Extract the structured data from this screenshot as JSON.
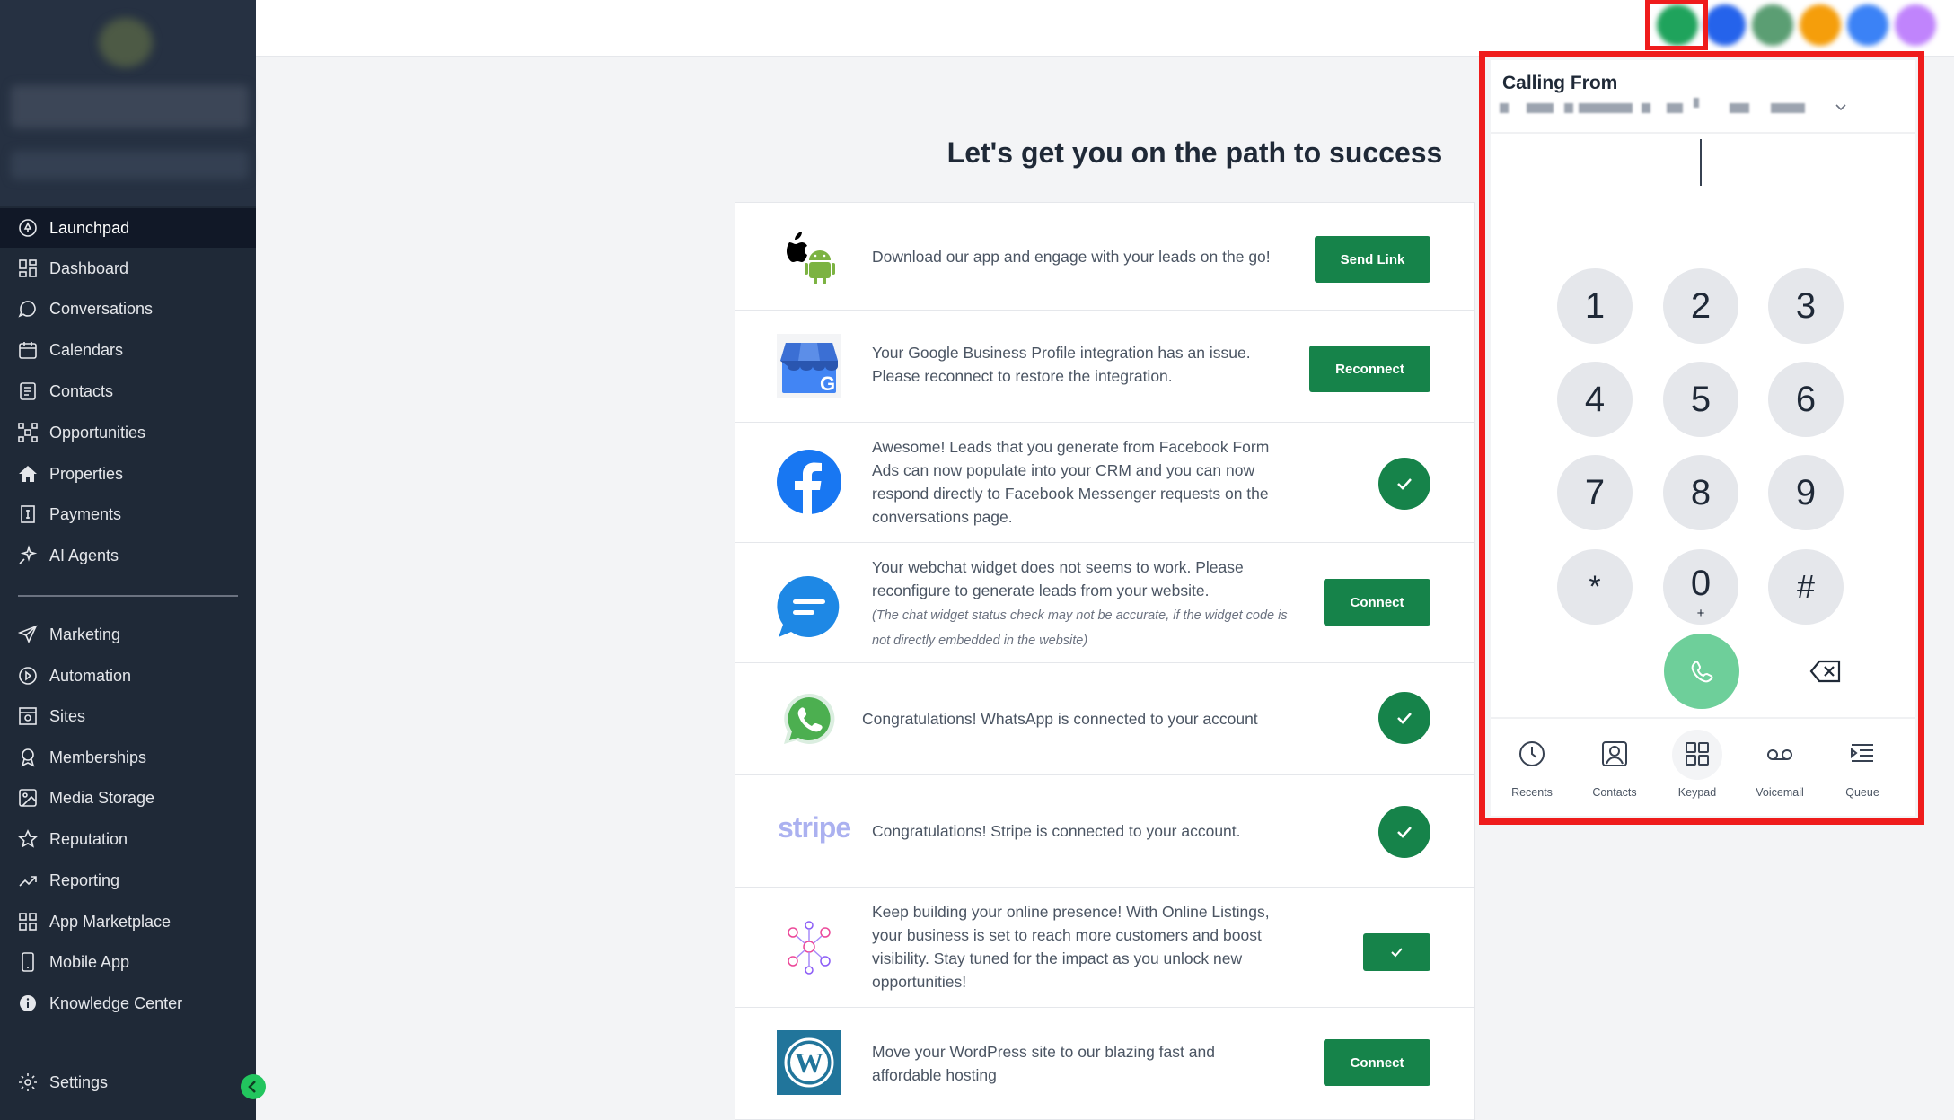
{
  "sidebar": {
    "items": [
      {
        "label": "Launchpad",
        "icon": "launchpad-icon",
        "active": true
      },
      {
        "label": "Dashboard",
        "icon": "dashboard-icon"
      },
      {
        "label": "Conversations",
        "icon": "chat-bubble-icon"
      },
      {
        "label": "Calendars",
        "icon": "calendar-icon"
      },
      {
        "label": "Contacts",
        "icon": "contacts-icon"
      },
      {
        "label": "Opportunities",
        "icon": "opportunities-icon"
      },
      {
        "label": "Properties",
        "icon": "home-icon"
      },
      {
        "label": "Payments",
        "icon": "payments-icon"
      },
      {
        "label": "AI Agents",
        "icon": "sparkle-icon"
      }
    ],
    "items2": [
      {
        "label": "Marketing",
        "icon": "send-icon"
      },
      {
        "label": "Automation",
        "icon": "automation-icon"
      },
      {
        "label": "Sites",
        "icon": "sites-icon"
      },
      {
        "label": "Memberships",
        "icon": "award-icon"
      },
      {
        "label": "Media Storage",
        "icon": "image-icon"
      },
      {
        "label": "Reputation",
        "icon": "star-icon"
      },
      {
        "label": "Reporting",
        "icon": "trend-icon"
      },
      {
        "label": "App Marketplace",
        "icon": "grid-icon"
      },
      {
        "label": "Mobile App",
        "icon": "phone-device-icon"
      },
      {
        "label": "Knowledge Center",
        "icon": "info-icon"
      }
    ],
    "settings": {
      "label": "Settings",
      "icon": "gear-icon"
    }
  },
  "main": {
    "title": "Let's get you on the path to success",
    "cards": [
      {
        "text": "Download our app and engage with your leads on the go!",
        "action": "Send Link"
      },
      {
        "text": "Your Google Business Profile integration has an issue. Please reconnect to restore the integration.",
        "action": "Reconnect"
      },
      {
        "text": "Awesome! Leads that you generate from Facebook Form Ads can now populate into your CRM and you can now respond directly to Facebook Messenger requests on the conversations page.",
        "status": "connected"
      },
      {
        "text": "Your webchat widget does not seems to work. Please reconfigure to generate leads from your website.",
        "note": "(The chat widget status check may not be accurate, if the widget code is not directly embedded in the website)",
        "action": "Connect"
      },
      {
        "text": "Congratulations! WhatsApp is connected to your account",
        "status": "connected"
      },
      {
        "text": "Congratulations! Stripe is connected to your account.",
        "logo": "stripe",
        "status": "connected"
      },
      {
        "text": "Keep building your online presence! With Online Listings, your business is set to reach more customers and boost visibility. Stay tuned for the impact as you unlock new opportunities!",
        "status": "connected"
      },
      {
        "text": "Move your WordPress site to our blazing fast and affordable hosting",
        "action": "Connect"
      }
    ]
  },
  "dialer": {
    "calling_from": "Calling From",
    "keys": [
      {
        "d": "1"
      },
      {
        "d": "2"
      },
      {
        "d": "3"
      },
      {
        "d": "4"
      },
      {
        "d": "5"
      },
      {
        "d": "6"
      },
      {
        "d": "7"
      },
      {
        "d": "8"
      },
      {
        "d": "9"
      },
      {
        "d": "*"
      },
      {
        "d": "0",
        "sub": "+"
      },
      {
        "d": "#"
      }
    ],
    "tabs": [
      {
        "label": "Recents",
        "icon": "clock-icon"
      },
      {
        "label": "Contacts",
        "icon": "contact-card-icon"
      },
      {
        "label": "Keypad",
        "icon": "keypad-icon",
        "active": true
      },
      {
        "label": "Voicemail",
        "icon": "voicemail-icon"
      },
      {
        "label": "Queue",
        "icon": "queue-icon"
      }
    ]
  },
  "colors": {
    "sidebar_bg": "#1f2937",
    "accent_green": "#16834a",
    "highlight_red": "#ef1c1c"
  }
}
